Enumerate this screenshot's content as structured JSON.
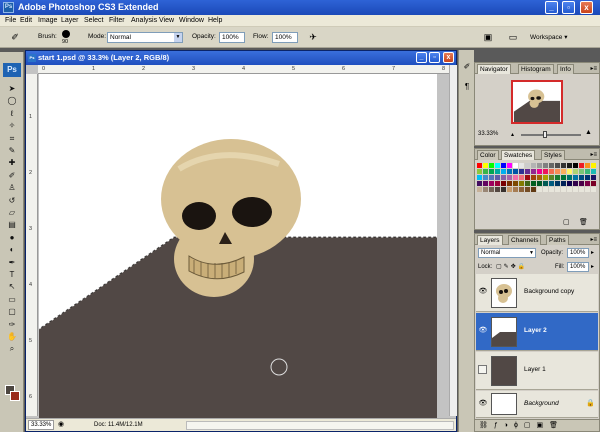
{
  "app": {
    "title": "Adobe Photoshop CS3 Extended",
    "icon": "Ps",
    "window_buttons": [
      "_",
      "▫",
      "x"
    ]
  },
  "menu": [
    "File",
    "Edit",
    "Image",
    "Layer",
    "Select",
    "Filter",
    "Analysis",
    "View",
    "Window",
    "Help"
  ],
  "options": {
    "brush_label": "Brush:",
    "brush_size": "90",
    "mode_label": "Mode:",
    "mode_value": "Normal",
    "opacity_label": "Opacity:",
    "opacity_value": "100%",
    "flow_label": "Flow:",
    "flow_value": "100%",
    "workspace_label": "Workspace ▾"
  },
  "toolbox": {
    "logo": "Ps",
    "tools": [
      {
        "name": "move-tool-icon",
        "glyph": "➤"
      },
      {
        "name": "marquee-tool-icon",
        "glyph": "◯"
      },
      {
        "name": "lasso-tool-icon",
        "glyph": "ℓ"
      },
      {
        "name": "magic-wand-tool-icon",
        "glyph": "✧"
      },
      {
        "name": "crop-tool-icon",
        "glyph": "⌗"
      },
      {
        "name": "slice-tool-icon",
        "glyph": "✎"
      },
      {
        "name": "healing-brush-tool-icon",
        "glyph": "✚"
      },
      {
        "name": "brush-tool-icon",
        "glyph": "✐"
      },
      {
        "name": "clone-stamp-tool-icon",
        "glyph": "♙"
      },
      {
        "name": "history-brush-tool-icon",
        "glyph": "↺"
      },
      {
        "name": "eraser-tool-icon",
        "glyph": "▱"
      },
      {
        "name": "gradient-tool-icon",
        "glyph": "▤"
      },
      {
        "name": "blur-tool-icon",
        "glyph": "●"
      },
      {
        "name": "dodge-tool-icon",
        "glyph": "◐"
      },
      {
        "name": "pen-tool-icon",
        "glyph": "✒"
      },
      {
        "name": "type-tool-icon",
        "glyph": "T"
      },
      {
        "name": "path-selection-tool-icon",
        "glyph": "↖"
      },
      {
        "name": "shape-tool-icon",
        "glyph": "▭"
      },
      {
        "name": "notes-tool-icon",
        "glyph": "▢"
      },
      {
        "name": "eyedropper-tool-icon",
        "glyph": "✑"
      },
      {
        "name": "hand-tool-icon",
        "glyph": "✋"
      },
      {
        "name": "zoom-tool-icon",
        "glyph": "⌕"
      }
    ],
    "foreground_color": "#4d4640",
    "background_color": "#9a2a1a"
  },
  "document": {
    "title": "start 1.psd @ 33.3% (Layer 2, RGB/8)",
    "zoom": "33.33%",
    "doc_info": "Doc: 11.4M/12.1M",
    "ruler_top": [
      "0",
      "1",
      "2",
      "3",
      "4",
      "5",
      "6",
      "7",
      "8"
    ],
    "ruler_left": [
      "1",
      "2",
      "3",
      "4",
      "5",
      "6"
    ],
    "floor_color": "#514845",
    "skull_color": "#d7c193"
  },
  "navigator": {
    "tabs": [
      "Navigator",
      "Histogram",
      "Info"
    ],
    "zoom": "33.33%",
    "slider_value": 0.4
  },
  "swatches": {
    "tabs": [
      "Color",
      "Swatches",
      "Styles"
    ],
    "colors": [
      "#ff0000",
      "#ffff00",
      "#00ff00",
      "#00ffff",
      "#0000ff",
      "#ff00ff",
      "#ffffff",
      "#e6e6e6",
      "#cccccc",
      "#b3b3b3",
      "#999999",
      "#808080",
      "#666666",
      "#4d4d4d",
      "#333333",
      "#1a1a1a",
      "#000000",
      "#ed1c24",
      "#f7941d",
      "#fff200",
      "#8dc63f",
      "#39b54a",
      "#00a651",
      "#00a99d",
      "#00aeef",
      "#0072bc",
      "#0054a6",
      "#2e3192",
      "#662d91",
      "#92278f",
      "#ec008c",
      "#ed145b",
      "#f26c4f",
      "#f68e56",
      "#fbaf5d",
      "#fff568",
      "#acd373",
      "#7cc576",
      "#3cb878",
      "#1cbbb4",
      "#00bff3",
      "#448ccb",
      "#5574b9",
      "#605ca8",
      "#8560a8",
      "#a864a8",
      "#f06eaa",
      "#f26d7d",
      "#9e0b0f",
      "#a0410d",
      "#a36209",
      "#aba000",
      "#598527",
      "#197b30",
      "#007236",
      "#00746b",
      "#0076a3",
      "#004b80",
      "#003471",
      "#1b1464",
      "#440e62",
      "#630460",
      "#9e005d",
      "#9e0039",
      "#790000",
      "#7b2e00",
      "#7d4900",
      "#827b00",
      "#406618",
      "#005e20",
      "#005826",
      "#005952",
      "#005b7f",
      "#003663",
      "#002157",
      "#0d004c",
      "#32004b",
      "#4b0049",
      "#7b0046",
      "#7a0026",
      "#c7b299",
      "#998675",
      "#736357",
      "#534741",
      "#37302d",
      "#c69c6d",
      "#a67c52",
      "#8c6239",
      "#754c24",
      "#603913",
      "#e8e6dc",
      "#e8e6dc",
      "#e8e6dc",
      "#e8e6dc",
      "#e8e6dc",
      "#e8e6dc",
      "#e8e6dc",
      "#e8e6dc",
      "#e8e6dc",
      "#e8e6dc"
    ]
  },
  "layers": {
    "tabs": [
      "Layers",
      "Channels",
      "Paths"
    ],
    "blend_mode": "Normal",
    "opacity_label": "Opacity:",
    "opacity_value": "100%",
    "lock_label": "Lock:",
    "fill_label": "Fill:",
    "fill_value": "100%",
    "items": [
      {
        "name": "Background copy",
        "visible": true,
        "selected": false
      },
      {
        "name": "Layer 2",
        "visible": true,
        "selected": true
      },
      {
        "name": "Layer 1",
        "visible": false,
        "selected": false
      },
      {
        "name": "Background",
        "visible": true,
        "selected": false
      }
    ]
  }
}
